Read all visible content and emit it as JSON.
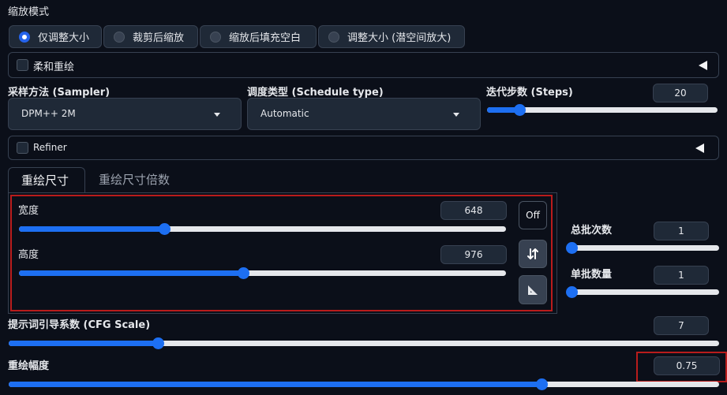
{
  "resize_mode": {
    "label": "缩放模式",
    "options": [
      "仅调整大小",
      "裁剪后缩放",
      "缩放后填充空白",
      "调整大小 (潜空间放大)"
    ],
    "selected": "仅调整大小"
  },
  "soft_inpaint": {
    "label": "柔和重绘",
    "checked": false
  },
  "sampler": {
    "label": "采样方法 (Sampler)",
    "value": "DPM++ 2M"
  },
  "schedule": {
    "label": "调度类型 (Schedule type)",
    "value": "Automatic"
  },
  "steps": {
    "label": "迭代步数 (Steps)",
    "value": "20",
    "fraction": 0.14
  },
  "refiner": {
    "label": "Refiner",
    "checked": false
  },
  "tabs": [
    {
      "label": "重绘尺寸",
      "active": true
    },
    {
      "label": "重绘尺寸倍数",
      "active": false
    }
  ],
  "width": {
    "label": "宽度",
    "value": "648",
    "fraction": 0.298
  },
  "height": {
    "label": "高度",
    "value": "976",
    "fraction": 0.46
  },
  "buttons": {
    "off_label": "Off",
    "swap_icon": "swap-vertical-icon",
    "ratio_icon": "triangle-ruler-icon"
  },
  "batch_count": {
    "label": "总批次数",
    "value": "1",
    "fraction": 0.0
  },
  "batch_size": {
    "label": "单批数量",
    "value": "1",
    "fraction": 0.0
  },
  "cfg": {
    "label": "提示词引导系数 (CFG Scale)",
    "value": "7",
    "fraction": 0.21
  },
  "denoise": {
    "label": "重绘幅度",
    "value": "0.75",
    "fraction": 0.75
  },
  "colors": {
    "accent": "#1d6ff2",
    "highlight": "#b91c1c",
    "background": "#0b0f19"
  }
}
